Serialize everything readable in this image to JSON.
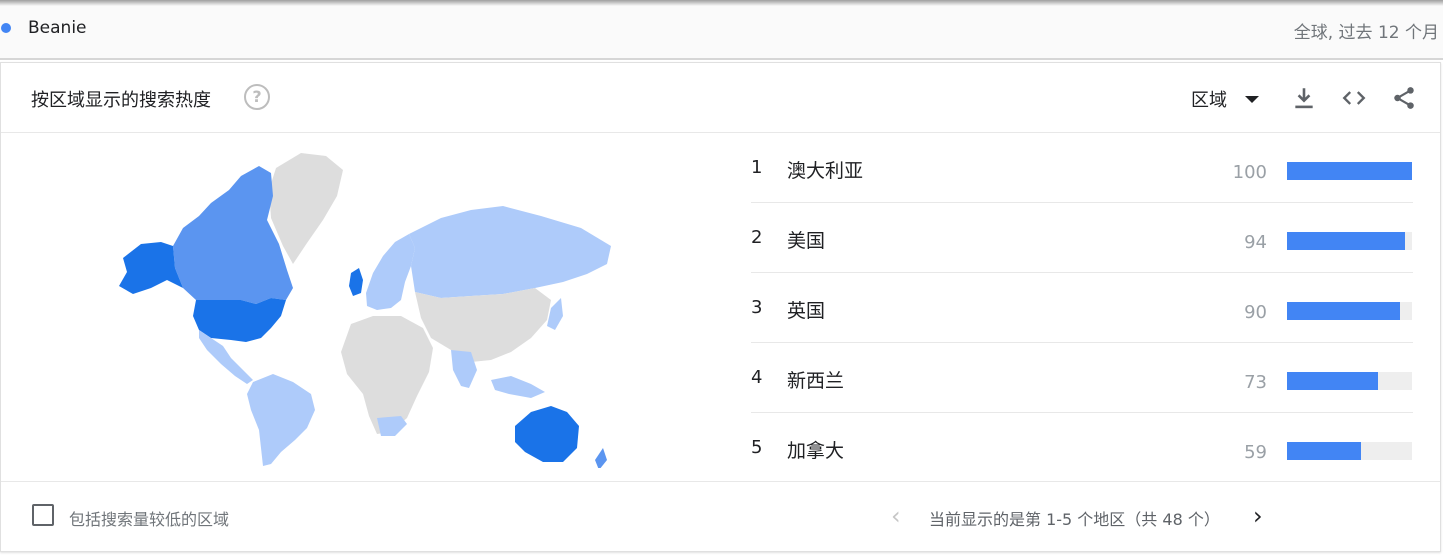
{
  "term": {
    "name": "Beanie",
    "dot_color": "#4285f4",
    "scope": "全球, 过去 12 个月"
  },
  "card": {
    "title": "按区域显示的搜索热度",
    "help_symbol": "?",
    "region_select_label": "区域",
    "icons": [
      "download-icon",
      "embed-code-icon",
      "share-icon"
    ]
  },
  "colors": {
    "high": "#1a73e8",
    "medium": "#5b95f0",
    "low": "#aecbfa",
    "no_data": "#dddddd",
    "bar": "#4285f4"
  },
  "ranking": [
    {
      "rank": "1",
      "name": "澳大利亚",
      "value": 100
    },
    {
      "rank": "2",
      "name": "美国",
      "value": 94
    },
    {
      "rank": "3",
      "name": "英国",
      "value": 90
    },
    {
      "rank": "4",
      "name": "新西兰",
      "value": 73
    },
    {
      "rank": "5",
      "name": "加拿大",
      "value": 59
    }
  ],
  "footer": {
    "checkbox_label": "包括搜索量较低的区域",
    "pager_prev": "‹",
    "pager_text": "当前显示的是第 1-5 个地区（共 48 个）",
    "pager_next": "›"
  }
}
